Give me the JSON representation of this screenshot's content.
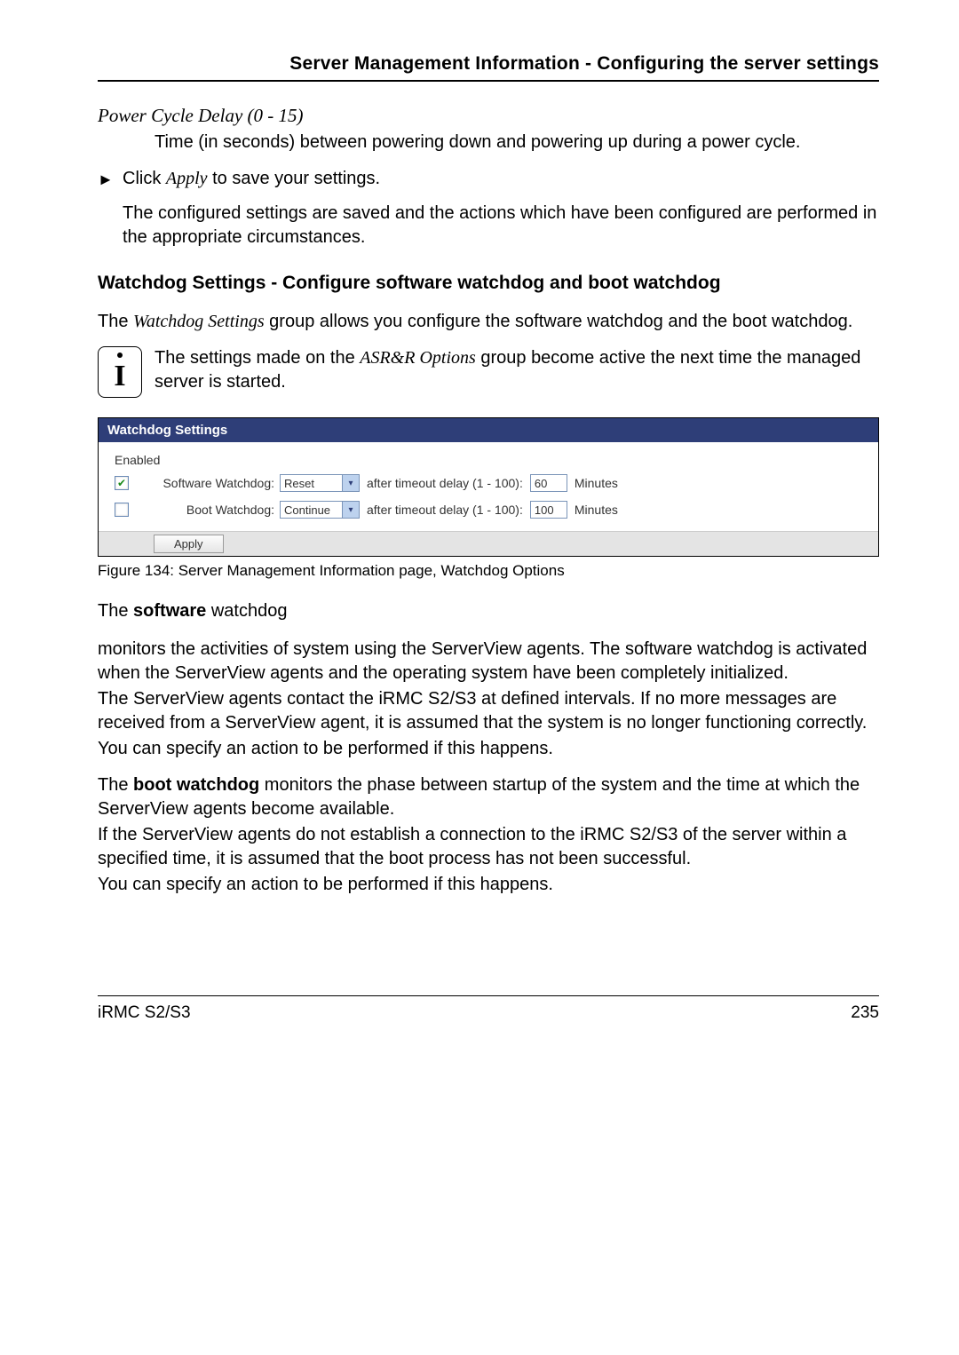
{
  "header": {
    "title": "Server Management Information - Configuring the server settings"
  },
  "powerCycle": {
    "heading": "Power Cycle Delay (0 - 15)",
    "desc": "Time (in seconds) between powering down and powering up during a power cycle."
  },
  "clickApply": {
    "pre": "Click ",
    "apply": "Apply",
    "post": " to save your settings."
  },
  "savedNote": "The configured settings are saved and the actions which have been configured are performed in the appropriate circumstances.",
  "watchdogHeading": "Watchdog Settings - Configure software watchdog and boot watchdog",
  "watchdogIntro": {
    "pre": "The ",
    "mid": "Watchdog Settings",
    "post": " group allows you configure the software watchdog and the boot watchdog."
  },
  "infoNote": {
    "pre": "The settings made on the ",
    "mid": "ASR&R Options",
    "post": " group become active the next time the managed server is started."
  },
  "panel": {
    "title": "Watchdog Settings",
    "enabledLabel": "Enabled",
    "rows": [
      {
        "checked": true,
        "label": "Software Watchdog:",
        "select": "Reset",
        "afterLabel": "after timeout delay (1 - 100):",
        "value": "60",
        "unit": "Minutes"
      },
      {
        "checked": false,
        "label": "Boot Watchdog:",
        "select": "Continue",
        "afterLabel": "after timeout delay (1 - 100):",
        "value": "100",
        "unit": "Minutes"
      }
    ],
    "applyLabel": "Apply"
  },
  "figCaption": "Figure 134: Server Management Information page, Watchdog Options",
  "swHeading": {
    "pre": "The ",
    "bold": "software",
    "post": " watchdog"
  },
  "swPara1": " monitors the activities of system using the ServerView agents. The software watchdog is activated when the ServerView agents and the operating system have been completely initialized.",
  "swPara2": "The ServerView agents contact the iRMC S2/S3 at defined intervals. If no more messages are received from a ServerView agent, it is assumed that the system is no longer functioning correctly.",
  "swPara3": "You can specify an action to be performed if this happens.",
  "bootPara1": {
    "pre": "The ",
    "bold": "boot watchdog",
    "post": " monitors the phase between startup of the system and the time at which the ServerView agents become available."
  },
  "bootPara2": "If the ServerView agents do not establish a connection to the iRMC S2/S3 of the server within a specified time, it is assumed that the boot process has not been successful.",
  "bootPara3": "You can specify an action to be performed if this happens.",
  "footer": {
    "left": "iRMC S2/S3",
    "right": "235"
  }
}
